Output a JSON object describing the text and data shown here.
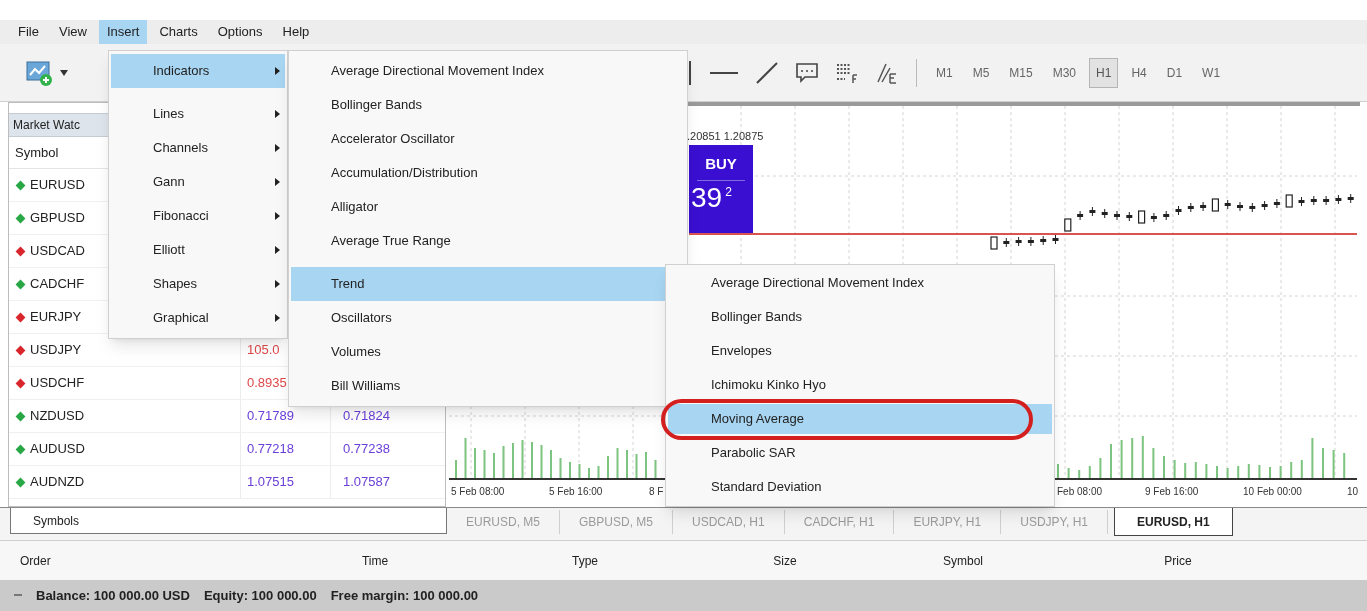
{
  "menu_bar": [
    {
      "label": "File",
      "selected": false
    },
    {
      "label": "View",
      "selected": false
    },
    {
      "label": "Insert",
      "selected": true
    },
    {
      "label": "Charts",
      "selected": false
    },
    {
      "label": "Options",
      "selected": false
    },
    {
      "label": "Help",
      "selected": false
    }
  ],
  "timeframes": [
    {
      "label": "M1",
      "selected": false
    },
    {
      "label": "M5",
      "selected": false
    },
    {
      "label": "M15",
      "selected": false
    },
    {
      "label": "M30",
      "selected": false
    },
    {
      "label": "H1",
      "selected": true
    },
    {
      "label": "H4",
      "selected": false
    },
    {
      "label": "D1",
      "selected": false
    },
    {
      "label": "W1",
      "selected": false
    }
  ],
  "market_watch": {
    "title": "Market Watc",
    "symbol_header": "Symbol",
    "rows": [
      {
        "symbol": "EURUSD",
        "falling": false
      },
      {
        "symbol": "GBPUSD",
        "falling": false
      },
      {
        "symbol": "USDCAD",
        "falling": true
      },
      {
        "symbol": "CADCHF",
        "falling": false
      },
      {
        "symbol": "EURJPY",
        "falling": true
      },
      {
        "symbol": "USDJPY",
        "falling": true,
        "bid": "105.0"
      },
      {
        "symbol": "USDCHF",
        "falling": true,
        "bid": "0.8935"
      },
      {
        "symbol": "NZDUSD",
        "falling": false,
        "bid": "0.71789",
        "ask": "0.71824"
      },
      {
        "symbol": "AUDUSD",
        "falling": false,
        "bid": "0.77218",
        "ask": "0.77238"
      },
      {
        "symbol": "AUDNZD",
        "falling": false,
        "bid": "1.07515",
        "ask": "1.07587"
      }
    ],
    "tab": "Symbols"
  },
  "chart": {
    "quote": ".20851 1.20875",
    "buy_label": "BUY",
    "buy_price": "39",
    "buy_price_sup": "2",
    "time_labels": [
      "5 Feb 08:00",
      "5 Feb 16:00",
      "8 F",
      "Feb 08:00",
      "9 Feb 16:00",
      "10 Feb 00:00",
      "10"
    ]
  },
  "chart_tabs": [
    {
      "label": "EURUSD, M5",
      "selected": false
    },
    {
      "label": "GBPUSD, M5",
      "selected": false
    },
    {
      "label": "USDCAD, H1",
      "selected": false
    },
    {
      "label": "CADCHF, H1",
      "selected": false
    },
    {
      "label": "EURJPY, H1",
      "selected": false
    },
    {
      "label": "USDJPY, H1",
      "selected": false
    },
    {
      "label": "EURUSD, H1",
      "selected": true
    }
  ],
  "orders_table": {
    "columns": [
      "Order",
      "Time",
      "Type",
      "Size",
      "Symbol",
      "Price"
    ]
  },
  "status_bar": [
    "Balance: 100 000.00 USD",
    "Equity: 100 000.00",
    "Free margin: 100 000.00"
  ],
  "insert_menu": [
    {
      "label": "Indicators",
      "kind": "submenu",
      "selected": true
    },
    {
      "kind": "separator"
    },
    {
      "label": "Lines",
      "kind": "submenu",
      "selected": false
    },
    {
      "label": "Channels",
      "kind": "submenu",
      "selected": false
    },
    {
      "label": "Gann",
      "kind": "submenu",
      "selected": false
    },
    {
      "label": "Fibonacci",
      "kind": "submenu",
      "selected": false
    },
    {
      "label": "Elliott",
      "kind": "submenu",
      "selected": false
    },
    {
      "label": "Shapes",
      "kind": "submenu",
      "selected": false
    },
    {
      "label": "Graphical",
      "kind": "submenu",
      "selected": false
    }
  ],
  "indicators_menu": [
    {
      "label": "Average Directional Movement Index",
      "kind": "item",
      "selected": false
    },
    {
      "label": "Bollinger Bands",
      "kind": "item",
      "selected": false
    },
    {
      "label": "Accelerator Oscillator",
      "kind": "item",
      "selected": false
    },
    {
      "label": "Accumulation/Distribution",
      "kind": "item",
      "selected": false
    },
    {
      "label": "Alligator",
      "kind": "item",
      "selected": false
    },
    {
      "label": "Average True Range",
      "kind": "item",
      "selected": false
    },
    {
      "kind": "separator"
    },
    {
      "label": "Trend",
      "kind": "submenu",
      "selected": true
    },
    {
      "label": "Oscillators",
      "kind": "submenu",
      "selected": false
    },
    {
      "label": "Volumes",
      "kind": "submenu",
      "selected": false
    },
    {
      "label": "Bill Williams",
      "kind": "submenu",
      "selected": false
    }
  ],
  "trend_menu": [
    {
      "label": "Average Directional Movement Index",
      "kind": "item",
      "selected": false
    },
    {
      "label": "Bollinger Bands",
      "kind": "item",
      "selected": false
    },
    {
      "label": "Envelopes",
      "kind": "item",
      "selected": false
    },
    {
      "label": "Ichimoku Kinko Hyo",
      "kind": "item",
      "selected": false
    },
    {
      "label": "Moving Average",
      "kind": "item",
      "selected": true
    },
    {
      "label": "Parabolic SAR",
      "kind": "item",
      "selected": false
    },
    {
      "label": "Standard Deviation",
      "kind": "item",
      "selected": false
    }
  ]
}
